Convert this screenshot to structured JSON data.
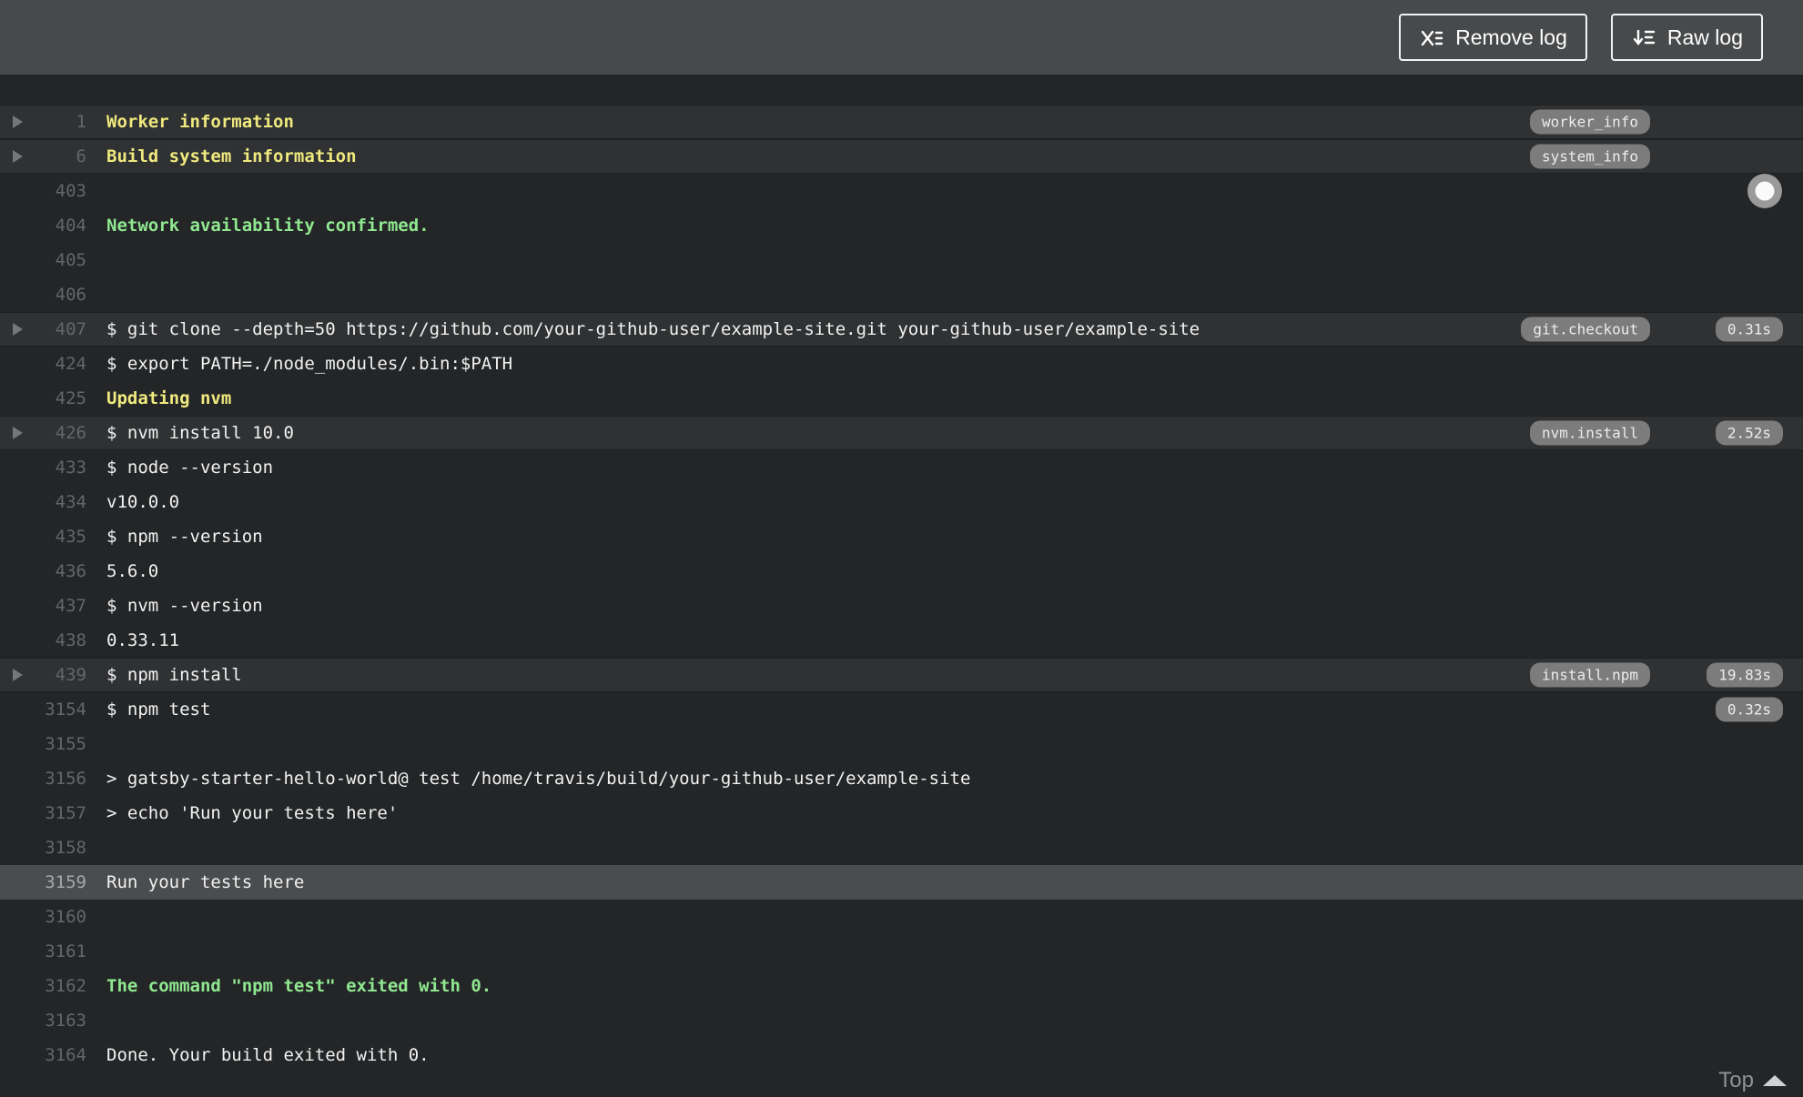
{
  "toolbar": {
    "remove_log_label": "Remove log",
    "raw_log_label": "Raw log"
  },
  "footer": {
    "top_label": "Top"
  },
  "colors": {
    "bar_bg": "#47494b",
    "log_bg": "#232527",
    "header_row_bg": "#2f3133",
    "selected_row_bg": "#4a4c4e",
    "pill_bg": "#7c7c7c",
    "accent_yellow": "#efe97e",
    "accent_green": "#90e890",
    "text_color": "#f2f2f2",
    "line_num": "#63676a"
  },
  "log": {
    "lines": [
      {
        "num": "1",
        "text": "Worker information",
        "color": "yellow",
        "fold": true,
        "header": true,
        "tag": "worker_info"
      },
      {
        "num": "6",
        "text": "Build system information",
        "color": "yellow",
        "fold": true,
        "header": true,
        "tag": "system_info"
      },
      {
        "num": "403",
        "text": ""
      },
      {
        "num": "404",
        "text": "Network availability confirmed.",
        "color": "green"
      },
      {
        "num": "405",
        "text": ""
      },
      {
        "num": "406",
        "text": ""
      },
      {
        "num": "407",
        "text": "$ git clone --depth=50 https://github.com/your-github-user/example-site.git your-github-user/example-site",
        "fold": true,
        "header": true,
        "tag": "git.checkout",
        "duration": "0.31s"
      },
      {
        "num": "424",
        "text": "$ export PATH=./node_modules/.bin:$PATH"
      },
      {
        "num": "425",
        "text": "Updating nvm",
        "color": "yellow"
      },
      {
        "num": "426",
        "text": "$ nvm install 10.0",
        "fold": true,
        "header": true,
        "tag": "nvm.install",
        "duration": "2.52s"
      },
      {
        "num": "433",
        "text": "$ node --version"
      },
      {
        "num": "434",
        "text": "v10.0.0"
      },
      {
        "num": "435",
        "text": "$ npm --version"
      },
      {
        "num": "436",
        "text": "5.6.0"
      },
      {
        "num": "437",
        "text": "$ nvm --version"
      },
      {
        "num": "438",
        "text": "0.33.11"
      },
      {
        "num": "439",
        "text": "$ npm install",
        "fold": true,
        "header": true,
        "tag": "install.npm",
        "duration": "19.83s"
      },
      {
        "num": "3154",
        "text": "$ npm test",
        "duration": "0.32s"
      },
      {
        "num": "3155",
        "text": ""
      },
      {
        "num": "3156",
        "text": "> gatsby-starter-hello-world@ test /home/travis/build/your-github-user/example-site"
      },
      {
        "num": "3157",
        "text": "> echo 'Run your tests here'"
      },
      {
        "num": "3158",
        "text": ""
      },
      {
        "num": "3159",
        "text": "Run your tests here",
        "selected": true
      },
      {
        "num": "3160",
        "text": ""
      },
      {
        "num": "3161",
        "text": ""
      },
      {
        "num": "3162",
        "text": "The command \"npm test\" exited with 0.",
        "color": "green"
      },
      {
        "num": "3163",
        "text": ""
      },
      {
        "num": "3164",
        "text": "Done. Your build exited with 0."
      }
    ]
  }
}
